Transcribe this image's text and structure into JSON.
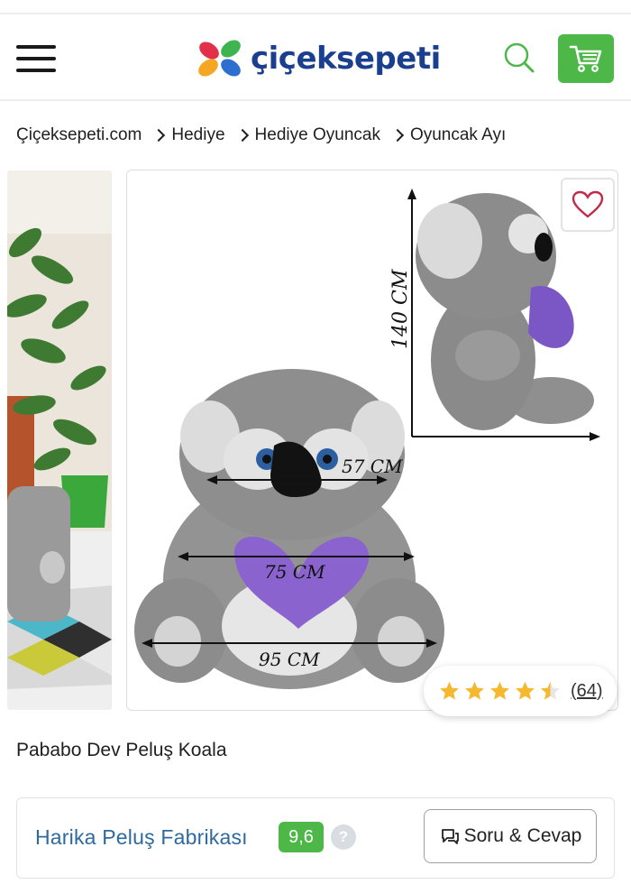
{
  "header": {
    "brand": "çiçeksepeti",
    "brand_colors": [
      "#e2304a",
      "#f5a623",
      "#3fb34f",
      "#2c6fd1"
    ],
    "accent_green": "#4db848"
  },
  "breadcrumb": [
    "Çiçeksepeti.com",
    "Hediye",
    "Hediye Oyuncak",
    "Oyuncak Ayı"
  ],
  "gallery": {
    "measurements": {
      "height": "140 CM",
      "head": "57 CM",
      "body": "75 CM",
      "width": "95 CM"
    }
  },
  "rating": {
    "stars": 4.5,
    "count": "(64)",
    "star_color": "#f5b82e"
  },
  "product": {
    "title": "Pababo Dev Peluş Koala"
  },
  "seller": {
    "name": "Harika Peluş Fabrikası",
    "score": "9,6",
    "help": "?",
    "qa_label": "Soru & Cevap"
  }
}
